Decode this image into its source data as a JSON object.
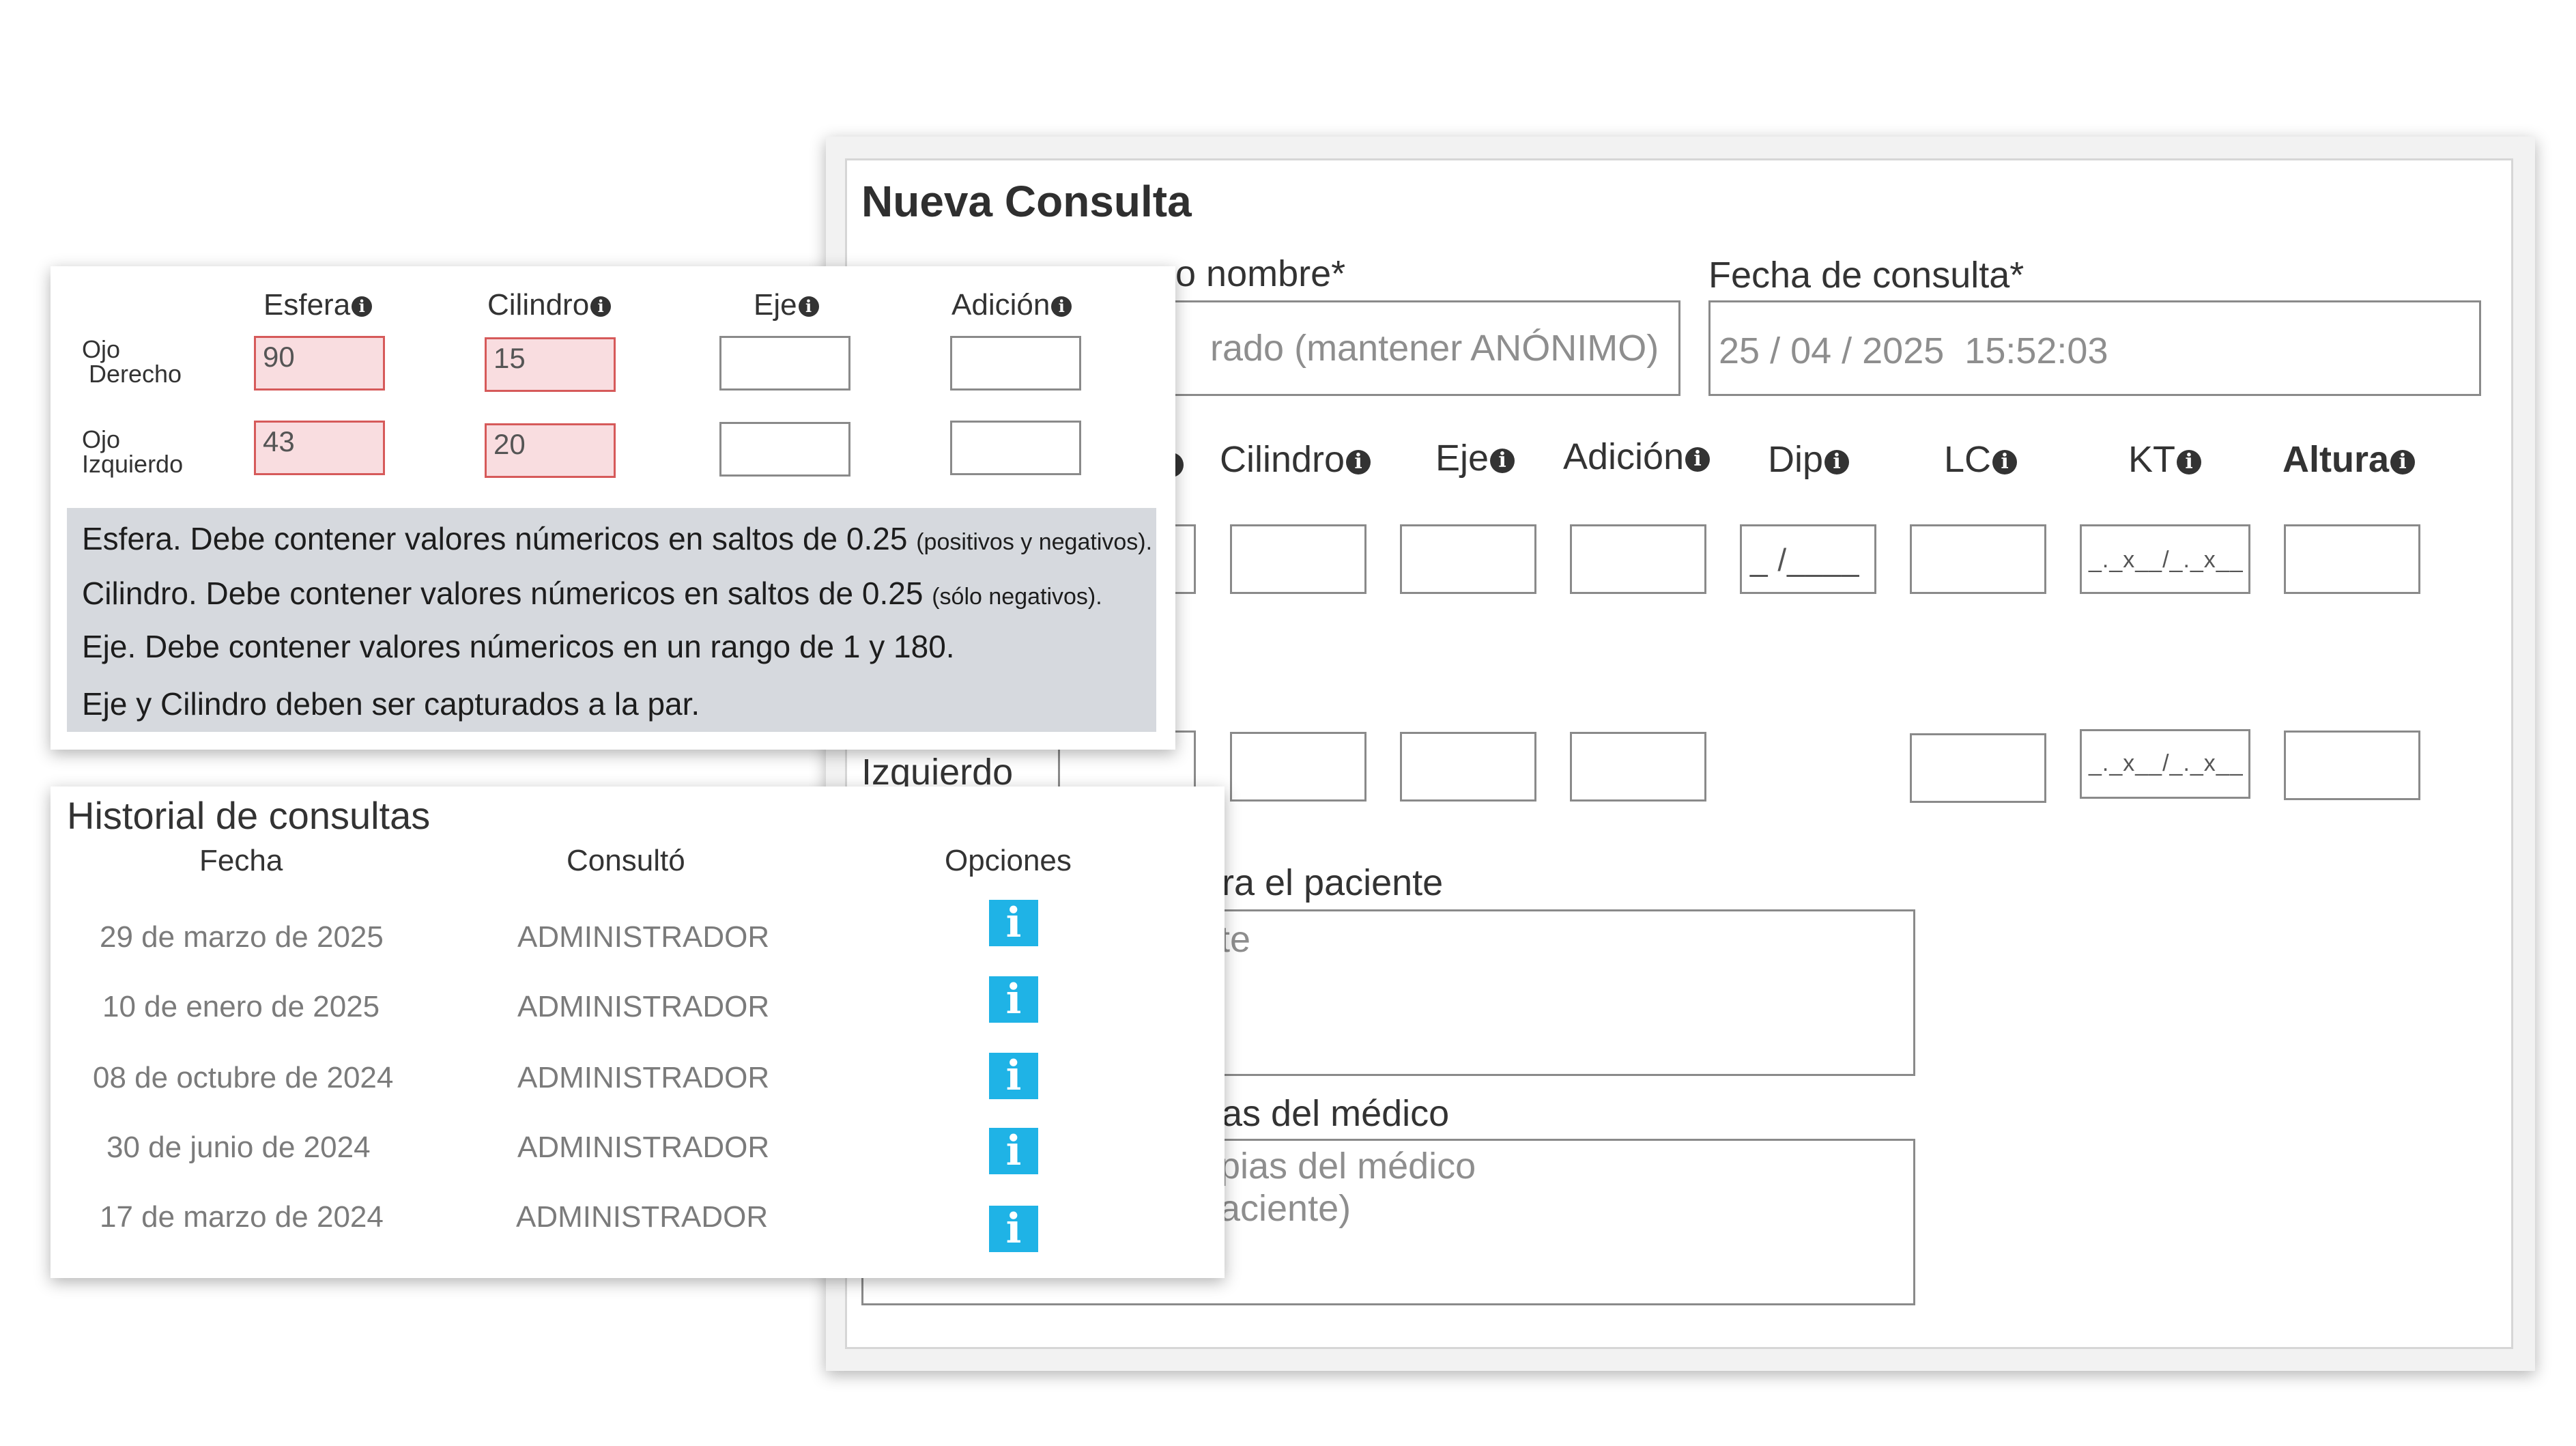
{
  "consulta": {
    "title": "Nueva Consulta",
    "patient_label_partial": "o nombre*",
    "patient_placeholder_partial": "rado (mantener ANÓNIMO)",
    "date_label": "Fecha de consulta*",
    "date_value": "25 / 04 / 2025  15:52:03",
    "columns": [
      "Cilindro",
      "Eje",
      "Adición",
      "Dip",
      "LC",
      "KT",
      "Altura"
    ],
    "dip_mask": "_ /____",
    "kt_mask": "_._x__/_._x__",
    "izquierdo_label": "Izquierdo",
    "patient_notes_label_partial": "ra el paciente",
    "patient_notes_placeholder_partial": "te",
    "doctor_notes_label_partial": "as del médico",
    "doctor_notes_placeholder_line1": "pias del médico",
    "doctor_notes_placeholder_line2": "aciente)"
  },
  "graduacion": {
    "columns": [
      "Esfera",
      "Cilindro",
      "Eje",
      "Adición"
    ],
    "rows": [
      {
        "label_line1": "Ojo",
        "label_line2": "Derecho",
        "esfera": "90",
        "cilindro": "15"
      },
      {
        "label_line1": "Ojo",
        "label_line2": "Izquierdo",
        "esfera": "43",
        "cilindro": "20"
      }
    ],
    "notes": [
      {
        "text": "Esfera. Debe contener valores númericos en saltos de 0.25 ",
        "small": "(positivos y negativos)."
      },
      {
        "text": "Cilindro. Debe contener valores númericos en saltos de 0.25 ",
        "small": "(sólo negativos)."
      },
      {
        "text": "Eje. Debe contener valores númericos en un rango de 1 y 180.",
        "small": ""
      },
      {
        "text": "Eje y Cilindro deben ser capturados a la par.",
        "small": ""
      }
    ]
  },
  "historial": {
    "title": "Historial de consultas",
    "headers": {
      "fecha": "Fecha",
      "consulto": "Consultó",
      "opciones": "Opciones"
    },
    "rows": [
      {
        "fecha": "29 de marzo de 2025",
        "consulto": "ADMINISTRADOR"
      },
      {
        "fecha": "10 de enero de 2025",
        "consulto": "ADMINISTRADOR"
      },
      {
        "fecha": "08 de octubre de 2024",
        "consulto": "ADMINISTRADOR"
      },
      {
        "fecha": "30 de junio de 2024",
        "consulto": "ADMINISTRADOR"
      },
      {
        "fecha": "17 de marzo de 2024",
        "consulto": "ADMINISTRADOR"
      }
    ],
    "info_icon": "i",
    "colors": {
      "info_button": "#1fb3e6",
      "error_border": "#d65a5a",
      "error_fill": "#f9dde0",
      "notes_bg": "#d6d9de"
    }
  },
  "icons": {
    "info": "i"
  }
}
